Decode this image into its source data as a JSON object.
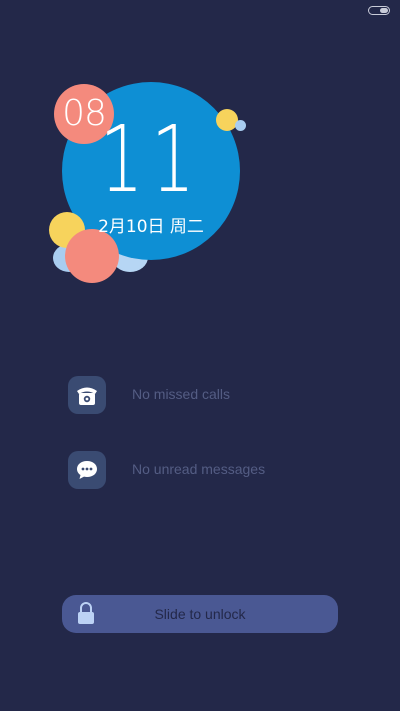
{
  "status_bar": {
    "battery_icon": "battery-icon"
  },
  "clock": {
    "hour": "11",
    "minute": "08",
    "date": "2月10日  周二"
  },
  "notifications": [
    {
      "icon": "phone-icon",
      "label": "No missed calls"
    },
    {
      "icon": "message-icon",
      "label": "No unread messages"
    }
  ],
  "unlock": {
    "icon": "lock-icon",
    "label": "Slide to unlock"
  },
  "colors": {
    "background": "#232849",
    "clock_circle": "#0e8fd4",
    "salmon": "#f48a7d",
    "yellow": "#f7d35c",
    "light_blue": "#a9cdf0",
    "icon_box": "#3a4b72",
    "unlock_bar": "#4a5893"
  }
}
